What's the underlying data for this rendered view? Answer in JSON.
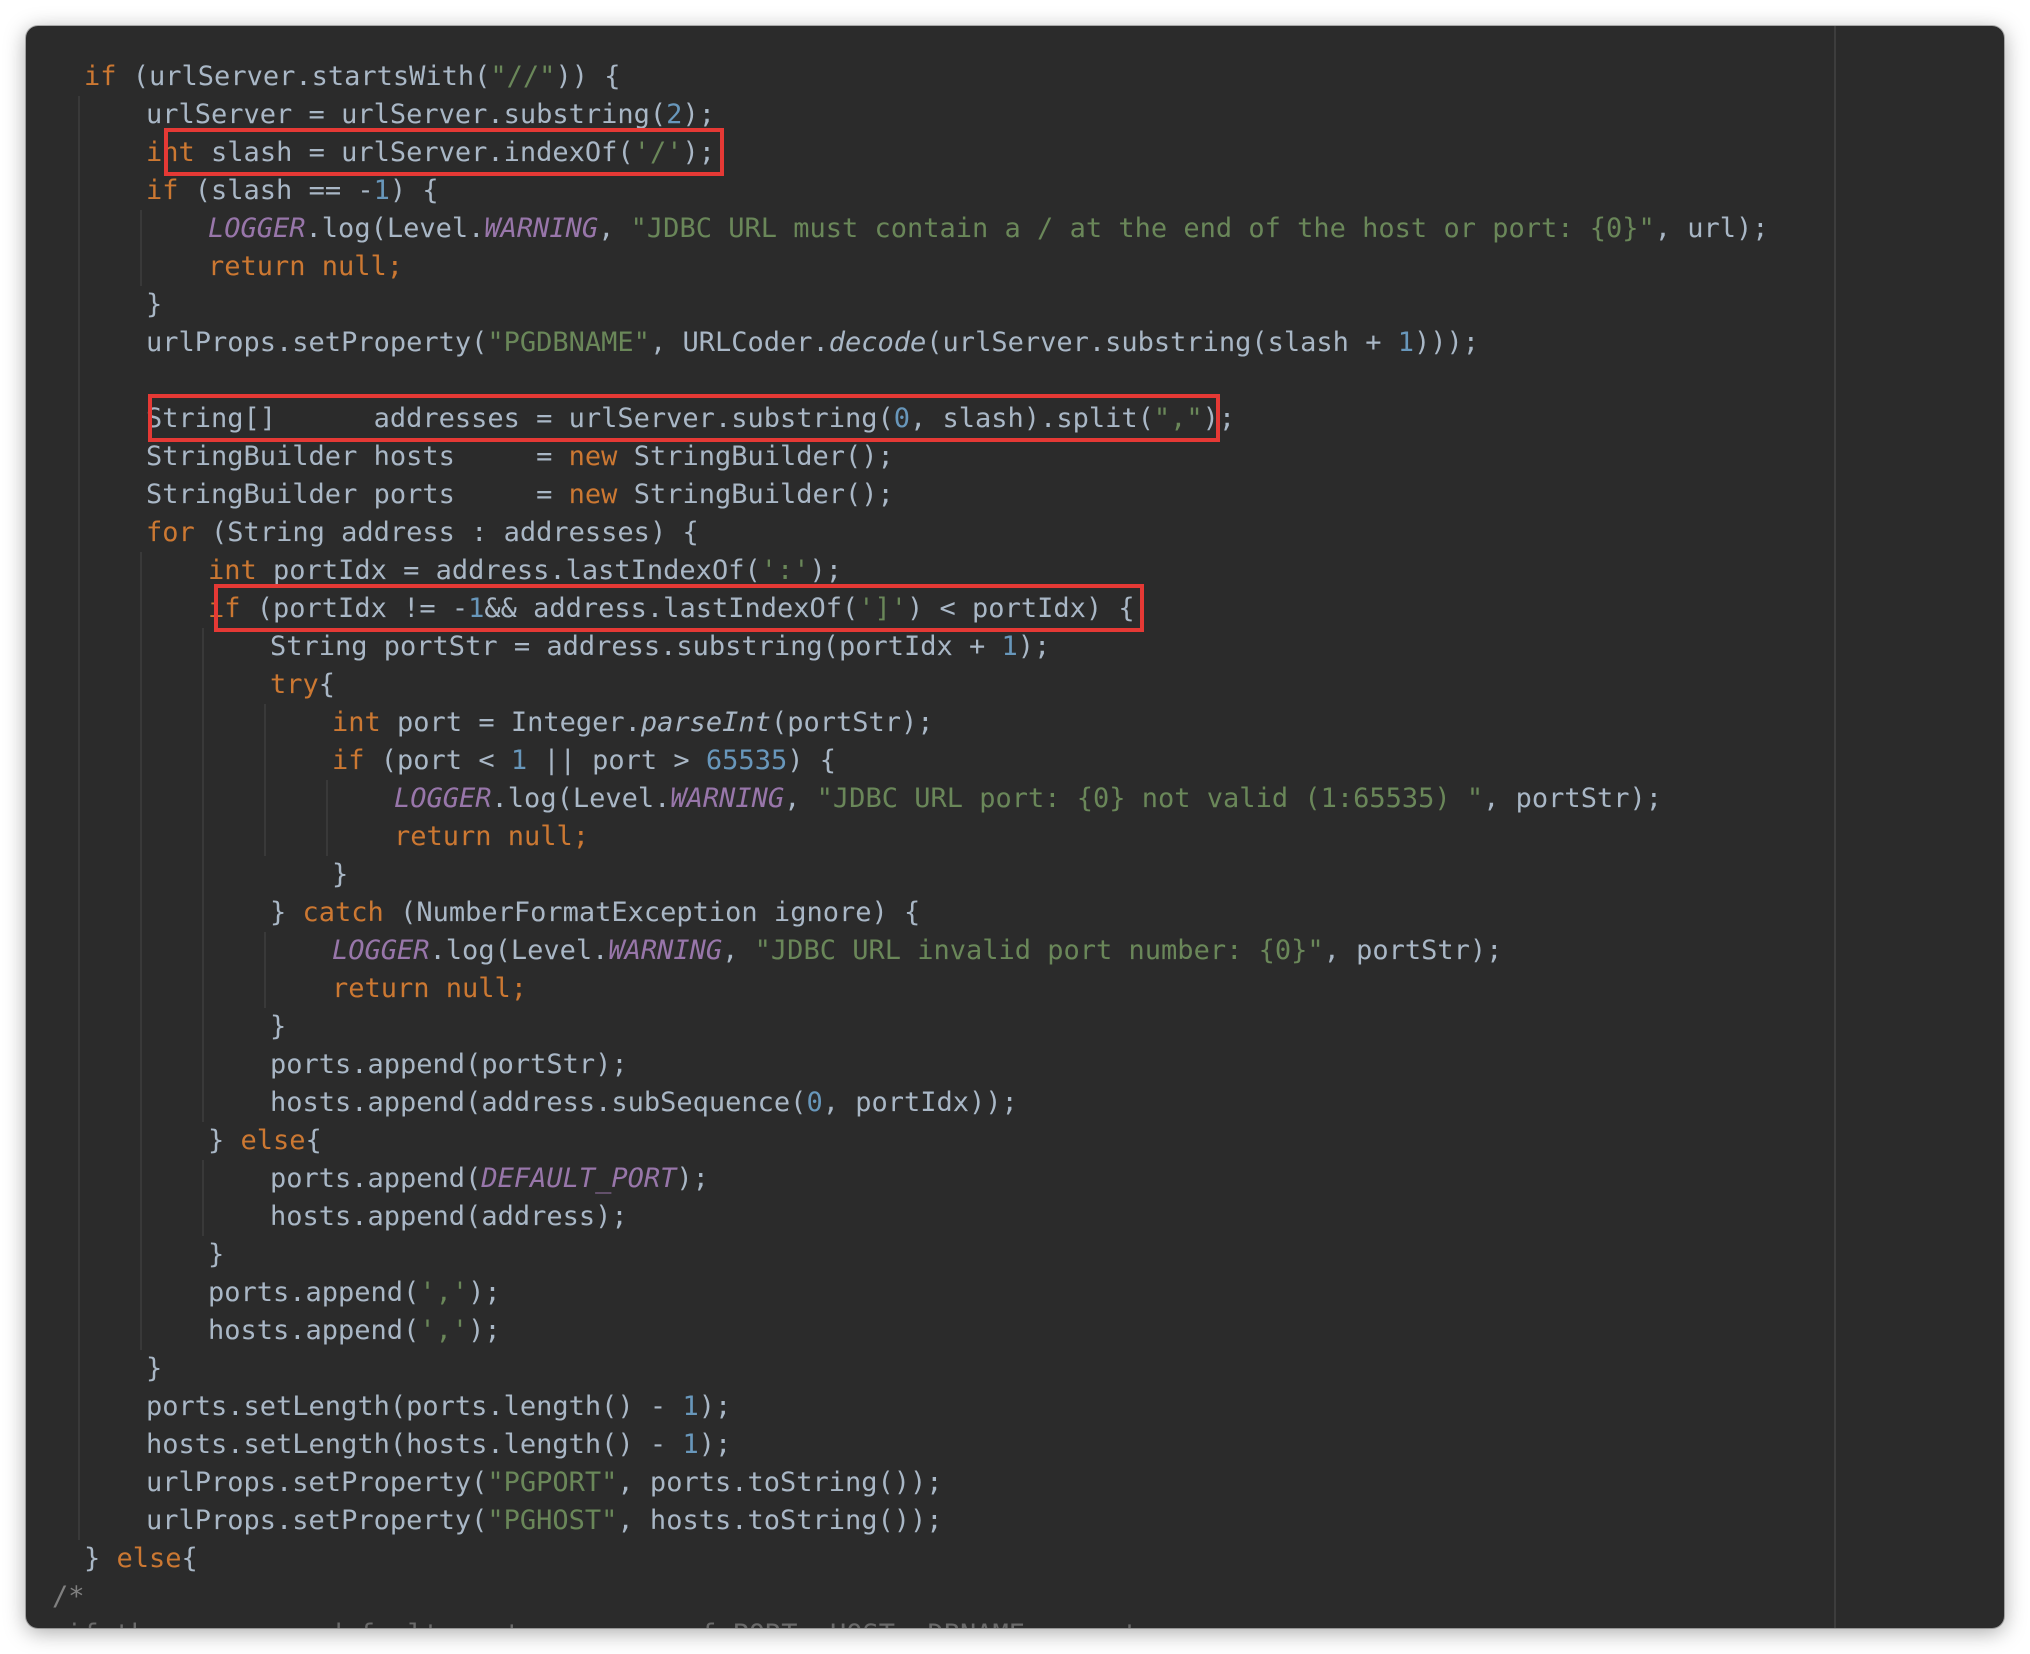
{
  "editor": {
    "colors": {
      "background": "#2b2b2b",
      "default": "#a9b7c6",
      "keyword": "#cc7832",
      "number": "#6897bb",
      "string": "#6a8759",
      "field": "#9876aa",
      "comment": "#808080",
      "highlight_box": "#e53935"
    },
    "highlighted_lines": [
      3,
      10,
      15
    ],
    "lines": [
      [
        [
          "kw",
          "if"
        ],
        [
          "",
          "(urlServer.startsWith("
        ],
        [
          "str",
          "\"//\""
        ],
        [
          "",
          ")) {"
        ]
      ],
      [
        [
          "",
          "urlServer = urlServer.substring("
        ],
        [
          "num",
          "2"
        ],
        [
          "",
          ");"
        ]
      ],
      [
        [
          "kw",
          "int"
        ],
        [
          "",
          "slash = urlServer.indexOf("
        ],
        [
          "str",
          "'/'"
        ],
        [
          "",
          ");"
        ]
      ],
      [
        [
          "kw",
          "if"
        ],
        [
          "",
          "(slash == -"
        ],
        [
          "num",
          "1"
        ],
        [
          "",
          ") {"
        ]
      ],
      [
        [
          "fld",
          "LOGGER"
        ],
        [
          "",
          ".log(Level."
        ],
        [
          "fld",
          "WARNING"
        ],
        [
          "",
          ", "
        ],
        [
          "str",
          "\"JDBC URL must contain a / at the end of the host or port: {0}\""
        ],
        [
          "",
          ", url);"
        ]
      ],
      [
        [
          "kw",
          "return null;"
        ]
      ],
      [
        [
          "",
          "}"
        ]
      ],
      [
        [
          "",
          "urlProps.setProperty("
        ],
        [
          "str",
          "\"PGDBNAME\""
        ],
        [
          "",
          ", URLCoder."
        ],
        [
          "it",
          "decode"
        ],
        [
          "",
          "(urlServer.substring(slash + "
        ],
        [
          "num",
          "1"
        ],
        [
          "",
          ")));"
        ]
      ],
      [],
      [
        [
          "",
          "String[]      addresses = urlServer.substring("
        ],
        [
          "num",
          "0"
        ],
        [
          "",
          ", slash).split("
        ],
        [
          "str",
          "\",\""
        ],
        [
          "",
          ");"
        ]
      ],
      [
        [
          "",
          "StringBuilder hosts     = "
        ],
        [
          "kw",
          "new"
        ],
        [
          "",
          "StringBuilder();"
        ]
      ],
      [
        [
          "",
          "StringBuilder ports     = "
        ],
        [
          "kw",
          "new"
        ],
        [
          "",
          "StringBuilder();"
        ]
      ],
      [
        [
          "kw",
          "for"
        ],
        [
          "",
          "(String address : addresses) {"
        ]
      ],
      [
        [
          "kw",
          "int"
        ],
        [
          "",
          "portIdx = address.lastIndexOf("
        ],
        [
          "str",
          "':'"
        ],
        [
          "",
          ");"
        ]
      ],
      [
        [
          "kw",
          "if"
        ],
        [
          "",
          "(portIdx != -"
        ],
        [
          "num",
          "1"
        ],
        [
          "",
          ""
        ],
        [
          "",
          "&& address.lastIndexOf("
        ],
        [
          "str",
          "']'"
        ],
        [
          "",
          ") < portIdx) {"
        ]
      ],
      [
        [
          "",
          "String portStr = address.substring(portIdx + "
        ],
        [
          "num",
          "1"
        ],
        [
          "",
          ");"
        ]
      ],
      [
        [
          "kw",
          "try"
        ],
        [
          "",
          "{"
        ]
      ],
      [
        [
          "kw",
          "int"
        ],
        [
          "",
          "port = Integer."
        ],
        [
          "it",
          "parseInt"
        ],
        [
          "",
          "(portStr);"
        ]
      ],
      [
        [
          "kw",
          "if"
        ],
        [
          "",
          "(port < "
        ],
        [
          "num",
          "1"
        ],
        [
          "",
          "|| port > "
        ],
        [
          "num",
          "65535"
        ],
        [
          "",
          ") {"
        ]
      ],
      [
        [
          "fld",
          "LOGGER"
        ],
        [
          "",
          ".log(Level."
        ],
        [
          "fld",
          "WARNING"
        ],
        [
          "",
          ", "
        ],
        [
          "str",
          "\"JDBC URL port: {0} not valid (1:65535) \""
        ],
        [
          "",
          ", portStr);"
        ]
      ],
      [
        [
          "kw",
          "return null;"
        ]
      ],
      [
        [
          "",
          "}"
        ]
      ],
      [
        [
          "",
          "} "
        ],
        [
          "kw",
          "catch"
        ],
        [
          "",
          "(NumberFormatException ignore) {"
        ]
      ],
      [
        [
          "fld",
          "LOGGER"
        ],
        [
          "",
          ".log(Level."
        ],
        [
          "fld",
          "WARNING"
        ],
        [
          "",
          ", "
        ],
        [
          "str",
          "\"JDBC URL invalid port number: {0}\""
        ],
        [
          "",
          ", portStr);"
        ]
      ],
      [
        [
          "kw",
          "return null;"
        ]
      ],
      [
        [
          "",
          "}"
        ]
      ],
      [
        [
          "",
          "ports.append(portStr);"
        ]
      ],
      [
        [
          "",
          "hosts.append(address.subSequence("
        ],
        [
          "num",
          "0"
        ],
        [
          "",
          ", portIdx));"
        ]
      ],
      [
        [
          "",
          "} "
        ],
        [
          "kw",
          "else"
        ],
        [
          "",
          "{"
        ]
      ],
      [
        [
          "",
          "ports.append("
        ],
        [
          "fld",
          "DEFAULT_PORT"
        ],
        [
          "",
          ");"
        ]
      ],
      [
        [
          "",
          "hosts.append(address);"
        ]
      ],
      [
        [
          "",
          "}"
        ]
      ],
      [
        [
          "",
          "ports.append("
        ],
        [
          "str",
          "','"
        ],
        [
          "",
          ");"
        ]
      ],
      [
        [
          "",
          "hosts.append("
        ],
        [
          "str",
          "','"
        ],
        [
          "",
          ");"
        ]
      ],
      [
        [
          "",
          "}"
        ]
      ],
      [
        [
          "",
          "ports.setLength(ports.length() - "
        ],
        [
          "num",
          "1"
        ],
        [
          "",
          ");"
        ]
      ],
      [
        [
          "",
          "hosts.setLength(hosts.length() - "
        ],
        [
          "num",
          "1"
        ],
        [
          "",
          ");"
        ]
      ],
      [
        [
          "",
          "urlProps.setProperty("
        ],
        [
          "str",
          "\"PGPORT\""
        ],
        [
          "",
          ", ports.toString());"
        ]
      ],
      [
        [
          "",
          "urlProps.setProperty("
        ],
        [
          "str",
          "\"PGHOST\""
        ],
        [
          "",
          ", hosts.toString());"
        ]
      ],
      [
        [
          "",
          "} "
        ],
        [
          "kw",
          "else"
        ],
        [
          "",
          "{"
        ]
      ],
      [
        [
          "cm",
          "/*"
        ]
      ],
      [
        [
          "cm-faded",
          "if there are no default port or a ... of PORT, HOST, DBNAME, ... to ..."
        ]
      ]
    ]
  }
}
